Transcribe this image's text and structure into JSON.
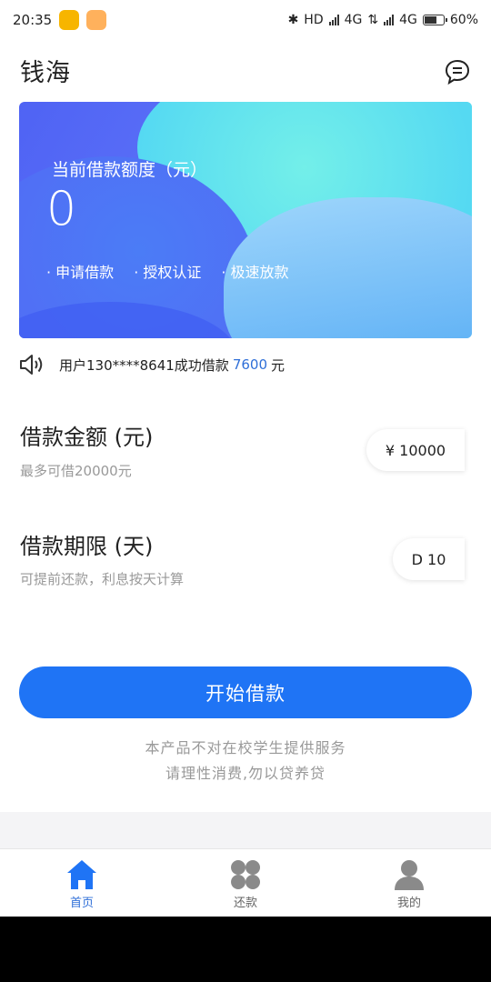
{
  "status": {
    "time": "20:35",
    "hd": "HD",
    "net1": "4G",
    "net2": "4G",
    "battery": "60%"
  },
  "header": {
    "title": "钱海"
  },
  "banner": {
    "label": "当前借款额度（元）",
    "amount": "0",
    "features": [
      "申请借款",
      "授权认证",
      "极速放款"
    ]
  },
  "notice": {
    "prefix": "用户130****8641成功借款",
    "amount": "7600",
    "suffix": "元"
  },
  "loan_amount": {
    "title": "借款金额 (元)",
    "subtitle": "最多可借20000元",
    "value": "¥ 10000"
  },
  "loan_term": {
    "title": "借款期限 (天)",
    "subtitle": "可提前还款，利息按天计算",
    "value": "D 10"
  },
  "cta": {
    "label": "开始借款"
  },
  "disclaimer": [
    "本产品不对在校学生提供服务",
    "请理性消费,勿以贷养贷"
  ],
  "tabs": [
    {
      "label": "首页",
      "icon": "home-icon"
    },
    {
      "label": "还款",
      "icon": "grid-icon"
    },
    {
      "label": "我的",
      "icon": "user-icon"
    }
  ],
  "colors": {
    "accent": "#1f74f5",
    "highlight": "#2f6fd8"
  }
}
